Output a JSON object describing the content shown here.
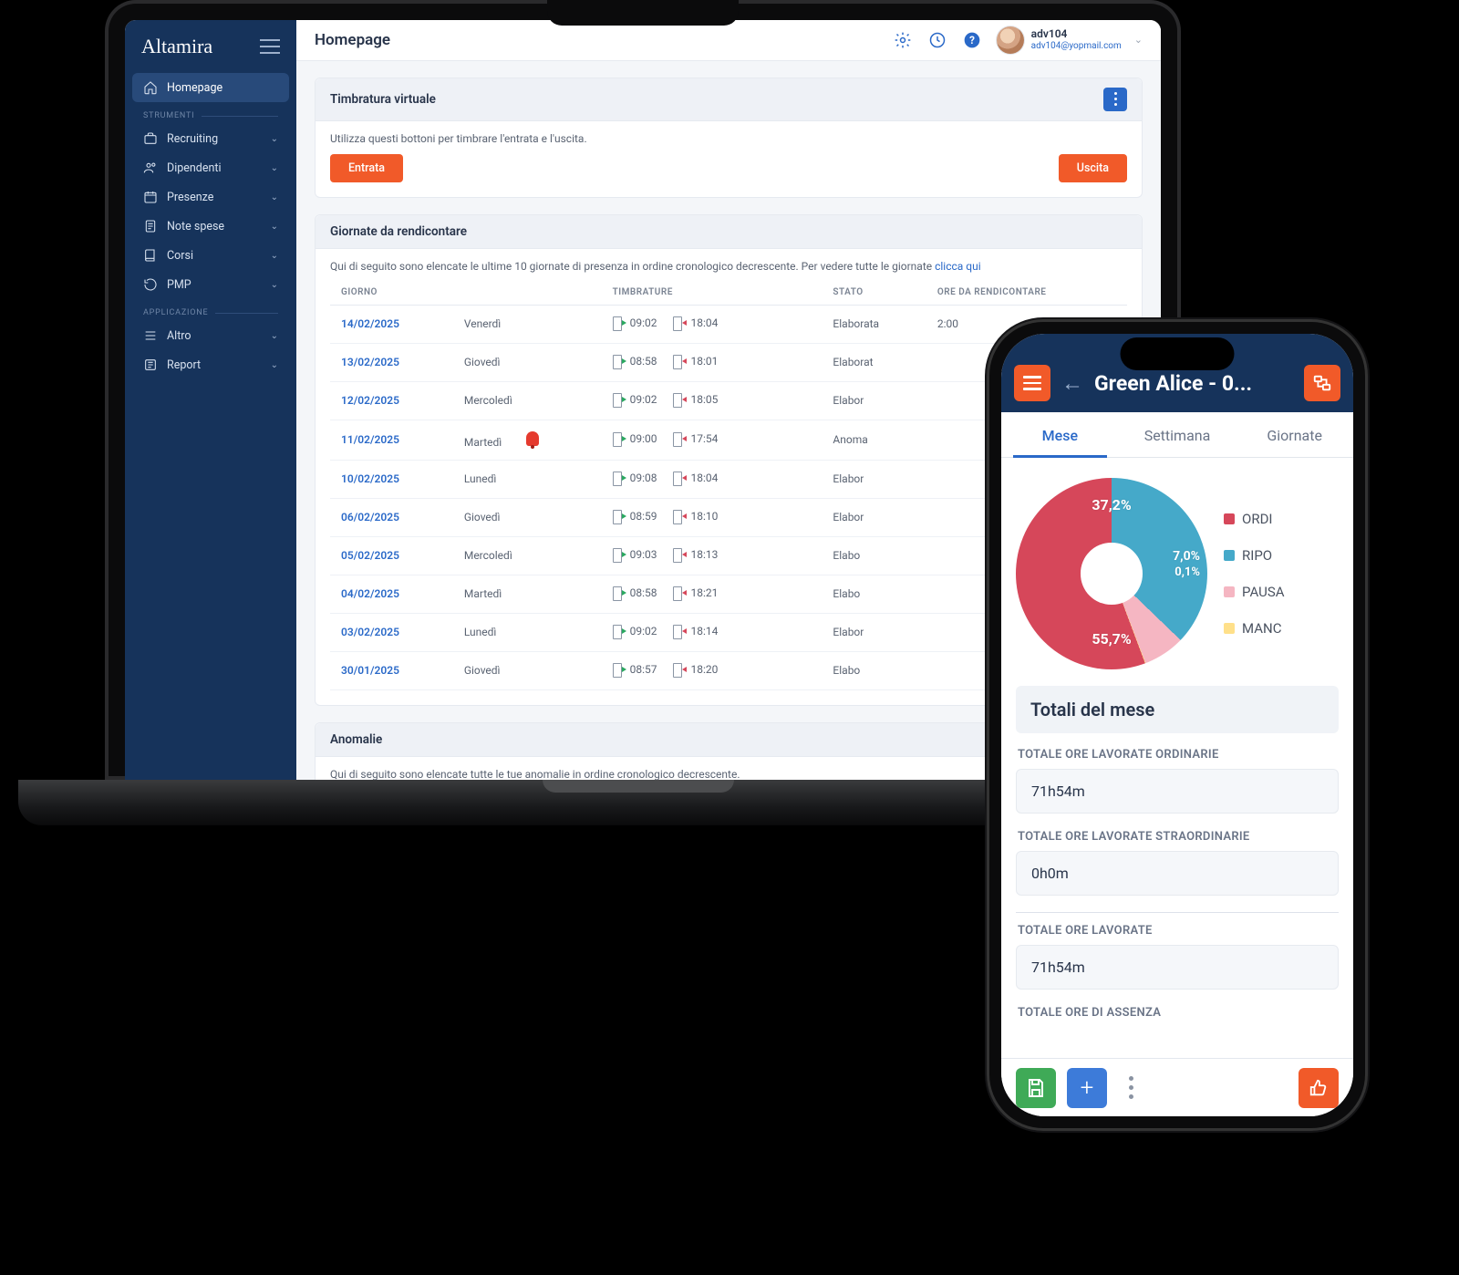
{
  "desktop": {
    "brand": "Altamira",
    "page_title": "Homepage",
    "user": {
      "name": "adv104",
      "email": "adv104@yopmail.com"
    },
    "sidebar": {
      "items": [
        {
          "label": "Homepage",
          "active": true
        },
        {
          "label": "Recruiting"
        },
        {
          "label": "Dipendenti"
        },
        {
          "label": "Presenze"
        },
        {
          "label": "Note spese"
        },
        {
          "label": "Corsi"
        },
        {
          "label": "PMP"
        }
      ],
      "section1": "STRUMENTI",
      "section2": "APPLICAZIONE",
      "items2": [
        {
          "label": "Altro"
        },
        {
          "label": "Report"
        }
      ]
    },
    "panel_timbratura": {
      "title": "Timbratura virtuale",
      "hint": "Utilizza questi bottoni per timbrare l'entrata e l'uscita.",
      "btn_in": "Entrata",
      "btn_out": "Uscita"
    },
    "panel_giornate": {
      "title": "Giornate da rendicontare",
      "hint": "Qui di seguito sono elencate le ultime 10 giornate di presenza in ordine cronologico decrescente. Per vedere tutte le giornate ",
      "hint_link": "clicca qui",
      "cols": [
        "GIORNO",
        "",
        "TIMBRATURE",
        "STATO",
        "ORE DA RENDICONTARE"
      ],
      "rows": [
        {
          "date": "14/02/2025",
          "dow": "Venerdì",
          "in": "09:02",
          "out": "18:04",
          "status": "Elaborata",
          "hours": "2:00",
          "alert": false
        },
        {
          "date": "13/02/2025",
          "dow": "Giovedì",
          "in": "08:58",
          "out": "18:01",
          "status": "Elaborat",
          "alert": false
        },
        {
          "date": "12/02/2025",
          "dow": "Mercoledì",
          "in": "09:02",
          "out": "18:05",
          "status": "Elabor",
          "alert": false
        },
        {
          "date": "11/02/2025",
          "dow": "Martedì",
          "in": "09:00",
          "out": "17:54",
          "status": "Anoma",
          "alert": true
        },
        {
          "date": "10/02/2025",
          "dow": "Lunedì",
          "in": "09:08",
          "out": "18:04",
          "status": "Elabor",
          "alert": false
        },
        {
          "date": "06/02/2025",
          "dow": "Giovedì",
          "in": "08:59",
          "out": "18:10",
          "status": "Elabor",
          "alert": false
        },
        {
          "date": "05/02/2025",
          "dow": "Mercoledì",
          "in": "09:03",
          "out": "18:13",
          "status": "Elabo",
          "alert": false
        },
        {
          "date": "04/02/2025",
          "dow": "Martedì",
          "in": "08:58",
          "out": "18:21",
          "status": "Elabo",
          "alert": false
        },
        {
          "date": "03/02/2025",
          "dow": "Lunedì",
          "in": "09:02",
          "out": "18:14",
          "status": "Elabor",
          "alert": false
        },
        {
          "date": "30/01/2025",
          "dow": "Giovedì",
          "in": "08:57",
          "out": "18:20",
          "status": "Elabo",
          "alert": false
        }
      ]
    },
    "panel_anomalie": {
      "title": "Anomalie",
      "hint": "Qui di seguito sono elencate tutte le tue anomalie in ordine cronologico decrescente."
    }
  },
  "mobile": {
    "title": "Green Alice - 0...",
    "tabs": [
      "Mese",
      "Settimana",
      "Giornate"
    ],
    "legend": [
      {
        "label": "ORDI",
        "color": "#d6475a"
      },
      {
        "label": "RIPO",
        "color": "#45a9c9"
      },
      {
        "label": "PAUSA",
        "color": "#f5b6c2"
      },
      {
        "label": "MANC",
        "color": "#ffe08a"
      }
    ],
    "chart_labels": {
      "ripo": "37,2%",
      "ordi": "55,7%",
      "pausa": "7,0%",
      "manc": "0,1%"
    },
    "totals_title": "Totali del mese",
    "stats": [
      {
        "label": "TOTALE ORE LAVORATE ORDINARIE",
        "value": "71h54m"
      },
      {
        "label": "TOTALE ORE LAVORATE STRAORDINARIE",
        "value": "0h0m"
      },
      {
        "label": "TOTALE ORE LAVORATE",
        "value": "71h54m"
      },
      {
        "label": "TOTALE ORE DI ASSENZA",
        "value": ""
      }
    ]
  },
  "chart_data": {
    "type": "pie",
    "title": "Totali del mese",
    "series": [
      {
        "name": "ORDI",
        "value": 55.7,
        "color": "#d6475a"
      },
      {
        "name": "RIPO",
        "value": 37.2,
        "color": "#45a9c9"
      },
      {
        "name": "PAUSA",
        "value": 7.0,
        "color": "#f5b6c2"
      },
      {
        "name": "MANC",
        "value": 0.1,
        "color": "#ffe08a"
      }
    ]
  }
}
